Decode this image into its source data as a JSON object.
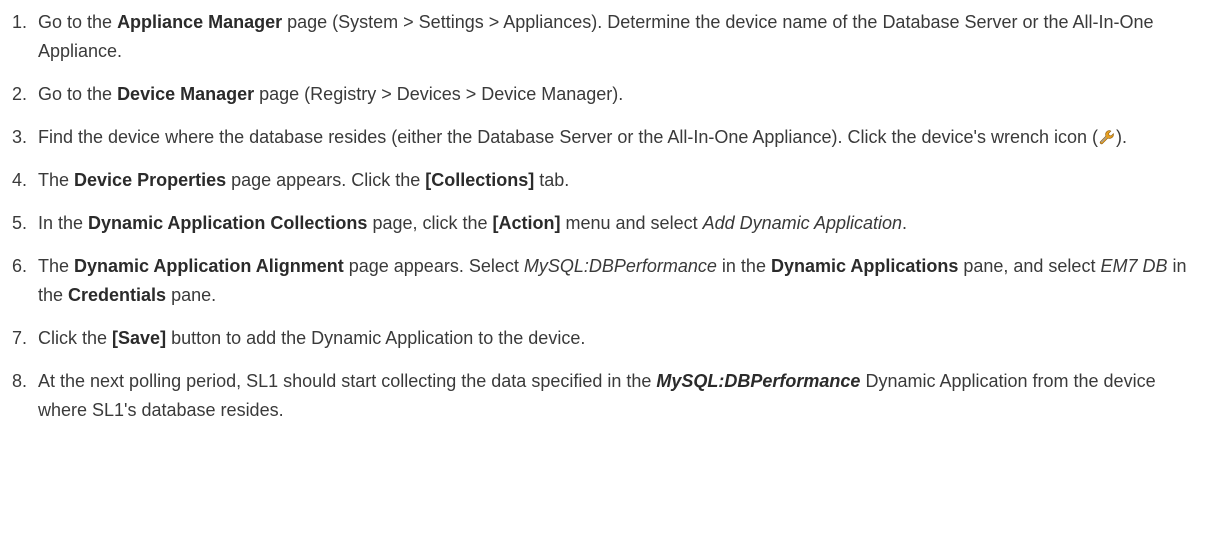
{
  "steps": [
    {
      "num": "1.",
      "parts": [
        {
          "t": "Go to the ",
          "s": ""
        },
        {
          "t": "Appliance Manager",
          "s": "b"
        },
        {
          "t": " page (System > Settings > Appliances). Determine the device name of the Database Server or the All-In-One Appliance.",
          "s": ""
        }
      ]
    },
    {
      "num": "2.",
      "parts": [
        {
          "t": "Go to the ",
          "s": ""
        },
        {
          "t": "Device Manager",
          "s": "b"
        },
        {
          "t": " page (Registry > Devices > Device Manager).",
          "s": ""
        }
      ]
    },
    {
      "num": "3.",
      "parts": [
        {
          "t": "Find the device where the database resides (either the Database Server or the All-In-One Appliance). Click the device's wrench icon (",
          "s": ""
        },
        {
          "t": "",
          "s": "icon"
        },
        {
          "t": ").",
          "s": ""
        }
      ]
    },
    {
      "num": "4.",
      "parts": [
        {
          "t": "The ",
          "s": ""
        },
        {
          "t": "Device Properties",
          "s": "b"
        },
        {
          "t": " page appears. Click the ",
          "s": ""
        },
        {
          "t": "[Collections]",
          "s": "b"
        },
        {
          "t": " tab.",
          "s": ""
        }
      ]
    },
    {
      "num": "5.",
      "parts": [
        {
          "t": "In the ",
          "s": ""
        },
        {
          "t": "Dynamic Application Collections",
          "s": "b"
        },
        {
          "t": " page, click the ",
          "s": ""
        },
        {
          "t": "[Action]",
          "s": "b"
        },
        {
          "t": " menu and select ",
          "s": ""
        },
        {
          "t": "Add Dynamic Application",
          "s": "i"
        },
        {
          "t": ".",
          "s": ""
        }
      ]
    },
    {
      "num": "6.",
      "parts": [
        {
          "t": "The ",
          "s": ""
        },
        {
          "t": "Dynamic Application Alignment",
          "s": "b"
        },
        {
          "t": " page appears. Select ",
          "s": ""
        },
        {
          "t": "MySQL:DBPerformance",
          "s": "i"
        },
        {
          "t": " in the ",
          "s": ""
        },
        {
          "t": "Dynamic Applications",
          "s": "b"
        },
        {
          "t": " pane, and select ",
          "s": ""
        },
        {
          "t": "EM7 DB",
          "s": "i"
        },
        {
          "t": " in the ",
          "s": ""
        },
        {
          "t": "Credentials",
          "s": "b"
        },
        {
          "t": " pane.",
          "s": ""
        }
      ]
    },
    {
      "num": "7.",
      "parts": [
        {
          "t": "Click the ",
          "s": ""
        },
        {
          "t": "[Save]",
          "s": "b"
        },
        {
          "t": " button to add the Dynamic Application to the device.",
          "s": ""
        }
      ]
    },
    {
      "num": "8.",
      "parts": [
        {
          "t": "At the next polling period, SL1 should start collecting the data specified in the ",
          "s": ""
        },
        {
          "t": "MySQL:DBPerformance",
          "s": "bi"
        },
        {
          "t": " Dynamic Application from the device where SL1's database resides.",
          "s": ""
        }
      ]
    }
  ],
  "icons": {
    "wrench": "wrench-icon"
  },
  "colors": {
    "text": "#3a3a3a",
    "wrench_body": "#e8a020",
    "wrench_shaft": "#a0a0a0"
  }
}
